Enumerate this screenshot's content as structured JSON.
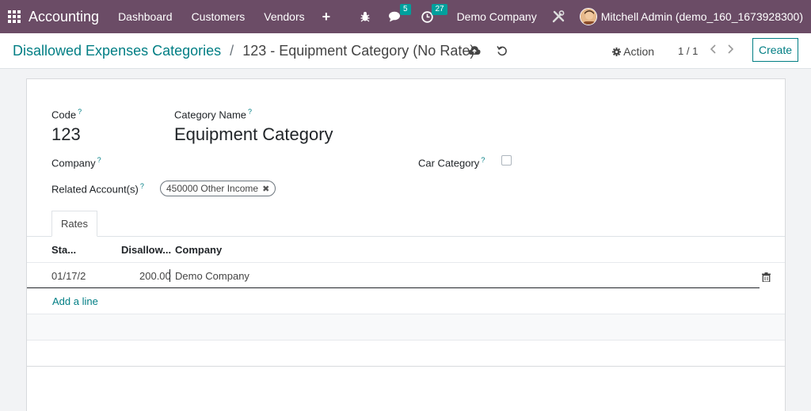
{
  "navbar": {
    "app_name": "Accounting",
    "menu": [
      "Dashboard",
      "Customers",
      "Vendors"
    ],
    "plus": "+",
    "chat_badge": "5",
    "activity_badge": "27",
    "company": "Demo Company",
    "user": "Mitchell Admin (demo_160_1673928300)"
  },
  "breadcrumb": {
    "parent": "Disallowed Expenses Categories",
    "separator": "/",
    "current": "123 - Equipment Category (No Rate)"
  },
  "control": {
    "action_label": "Action",
    "pager": "1 / 1",
    "create_label": "Create"
  },
  "form": {
    "code_label": "Code",
    "code_value": "123",
    "name_label": "Category Name",
    "name_value": "Equipment Category",
    "company_label": "Company",
    "car_label": "Car Category",
    "car_checked": false,
    "accounts_label": "Related Account(s)",
    "account_tag": "450000 Other Income",
    "help_mark": "?"
  },
  "tabs": {
    "rates": "Rates"
  },
  "table": {
    "headers": [
      "Sta...",
      "Disallow...",
      "Company"
    ],
    "rows": [
      {
        "start": "01/17/2",
        "rate": "200.00",
        "company": "Demo Company"
      }
    ],
    "add_line": "Add a line"
  }
}
